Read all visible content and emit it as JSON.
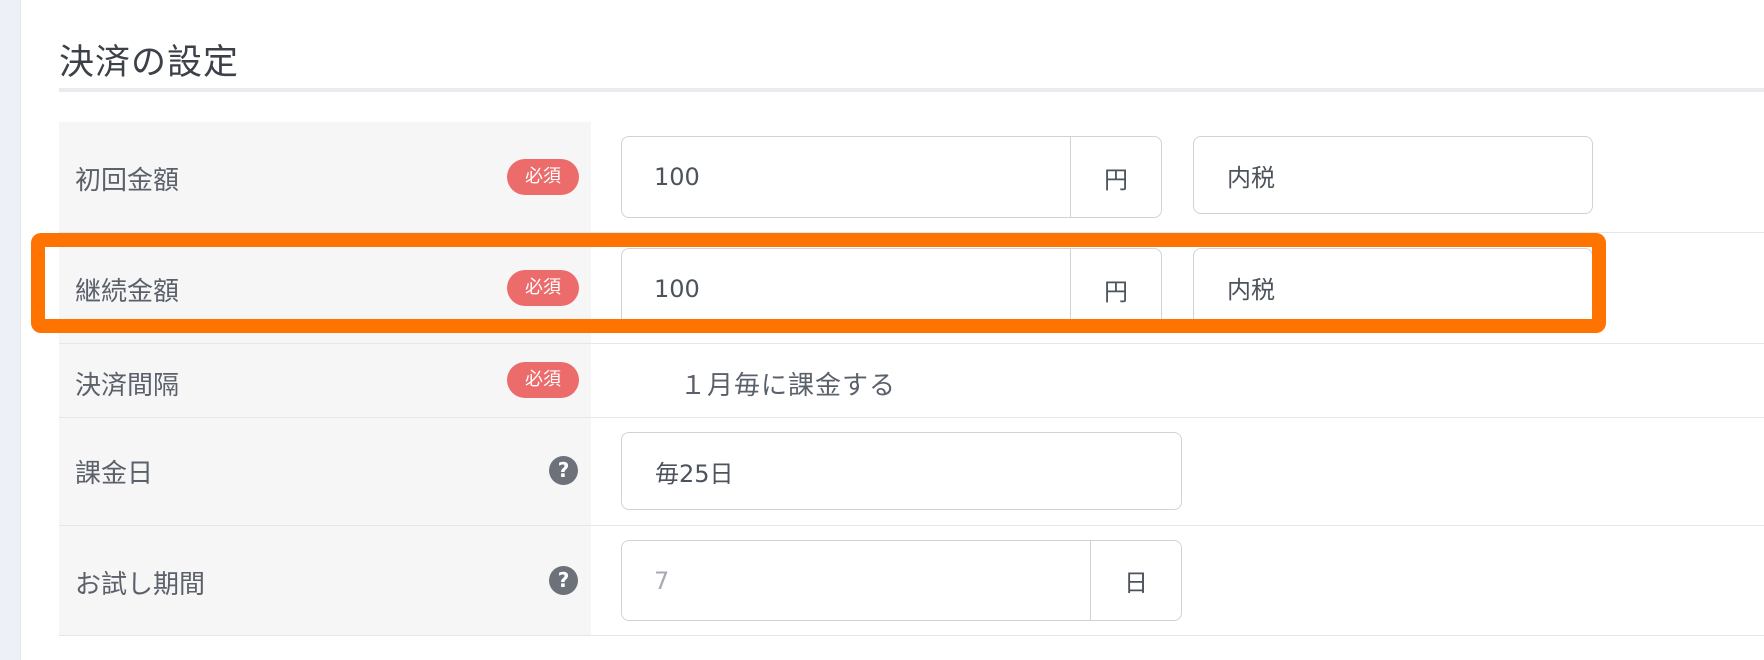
{
  "section": {
    "title": "決済の設定"
  },
  "rows": [
    {
      "label": "初回金額",
      "badge": "必須",
      "value": "100",
      "unit": "円",
      "tax": "内税"
    },
    {
      "label": "継続金額",
      "badge": "必須",
      "value": "100",
      "unit": "円",
      "tax": "内税"
    },
    {
      "label": "決済間隔",
      "badge": "必須",
      "value": "１月毎に課金する"
    },
    {
      "label": "課金日",
      "help_icon": "question-icon",
      "value": "毎25日"
    },
    {
      "label": "お試し期間",
      "help_icon": "question-icon",
      "placeholder": "7",
      "unit": "日"
    }
  ],
  "colors": {
    "required_badge": "#ec6b6b",
    "highlight": "#ff7300",
    "help_icon": "#6c717a"
  }
}
